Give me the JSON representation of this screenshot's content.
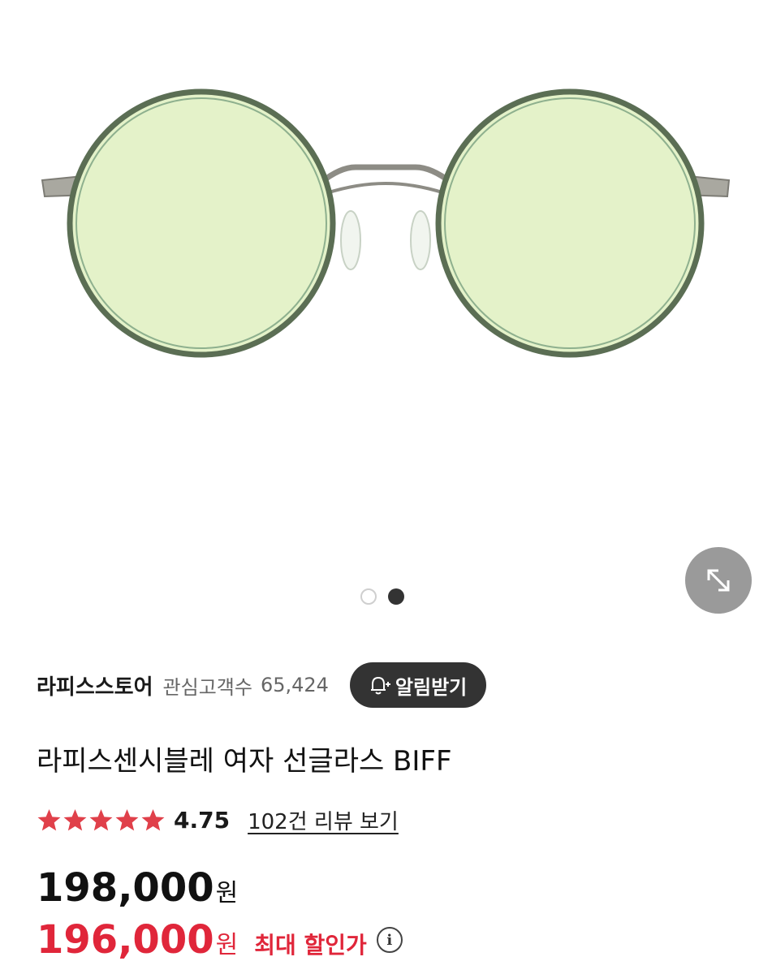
{
  "gallery": {
    "image_alt_icon": "sunglasses-image",
    "zoom_icon": "expand-arrows-icon",
    "pagination": {
      "current": 2,
      "total": 2
    }
  },
  "store": {
    "name": "라피스스토어",
    "follower_label": "관심고객수",
    "follower_count": "65,424",
    "notify_label": "알림받기",
    "notify_icon": "bell-plus-icon"
  },
  "product": {
    "title": "라피스센시블레 여자 선글라스 BIFF",
    "rating": {
      "stars": 5,
      "value": "4.75"
    },
    "review_link": "102건 리뷰 보기",
    "price_original": {
      "amount": "198,000",
      "unit": "원"
    },
    "price_sale": {
      "amount": "196,000",
      "unit": "원",
      "label": "최대 할인가",
      "info_icon": "i"
    }
  },
  "colors": {
    "accent_red": "#e0263a",
    "star_red": "#e0404a",
    "dark_button": "#333333",
    "zoom_button": "#9a9a9a"
  }
}
